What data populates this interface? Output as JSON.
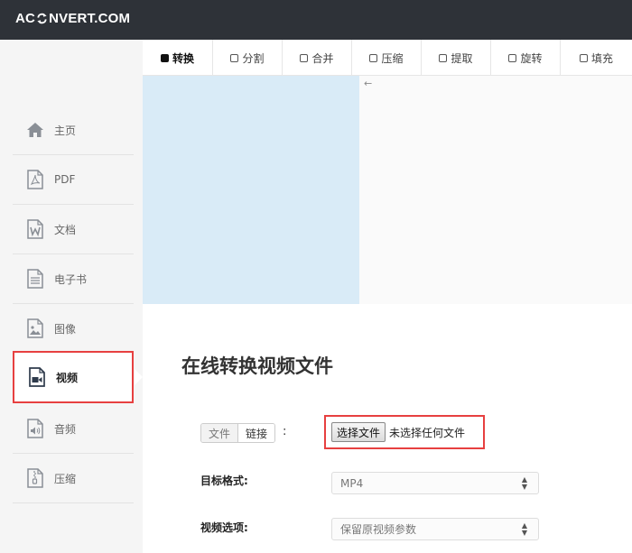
{
  "header": {
    "logo_left": "AC",
    "logo_right": "NVERT.COM"
  },
  "tabs": [
    {
      "label": "转换",
      "active": true
    },
    {
      "label": "分割",
      "active": false
    },
    {
      "label": "合并",
      "active": false
    },
    {
      "label": "压缩",
      "active": false
    },
    {
      "label": "提取",
      "active": false
    },
    {
      "label": "旋转",
      "active": false
    },
    {
      "label": "填充",
      "active": false
    }
  ],
  "sidebar": {
    "items": [
      {
        "label": "主页",
        "icon": "home-icon"
      },
      {
        "label": "PDF",
        "icon": "pdf-icon"
      },
      {
        "label": "文档",
        "icon": "word-document-icon"
      },
      {
        "label": "电子书",
        "icon": "ebook-icon"
      },
      {
        "label": "图像",
        "icon": "image-icon"
      },
      {
        "label": "视频",
        "icon": "video-icon",
        "active": true
      },
      {
        "label": "音频",
        "icon": "audio-icon"
      },
      {
        "label": "压缩",
        "icon": "archive-icon"
      }
    ]
  },
  "ad": {
    "arrow": "←"
  },
  "main": {
    "title": "在线转换视频文件",
    "source_toggle": {
      "file": "文件",
      "link": "链接",
      "colon": ":"
    },
    "file_input": {
      "button": "选择文件",
      "status": "未选择任何文件"
    },
    "target_format": {
      "label": "目标格式:",
      "value": "MP4"
    },
    "video_options": {
      "label": "视频选项:",
      "value": "保留原视频参数"
    }
  },
  "colors": {
    "header_bg": "#2e3238",
    "highlight": "#e74040",
    "ad_blue": "#d9ebf7"
  }
}
